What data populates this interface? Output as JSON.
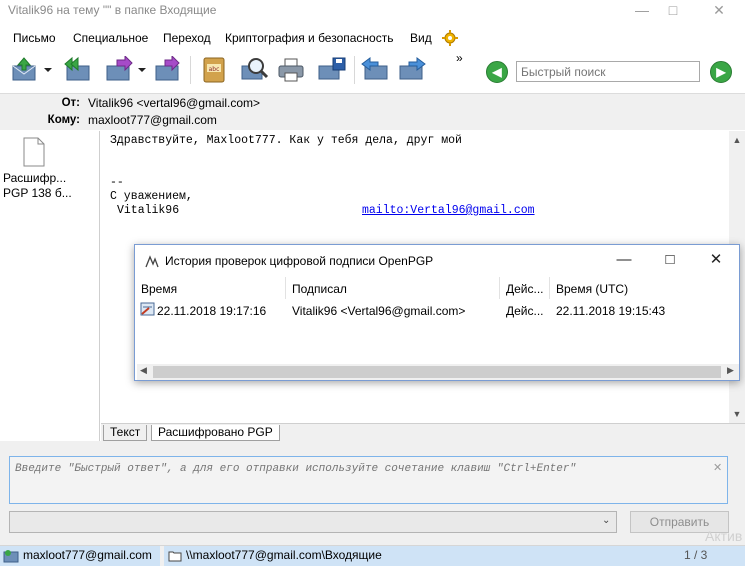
{
  "window": {
    "title": "Vitalik96 на тему \"\" в папке Входящие"
  },
  "menu": [
    "Письмо",
    "Специальное",
    "Переход",
    "Криптография и безопасность",
    "Вид"
  ],
  "toolbar": {
    "more_label": "»",
    "search_placeholder": "Быстрый поиск"
  },
  "header": {
    "from_label": "От:",
    "from_value": "Vitalik96 <vertal96@gmail.com>",
    "to_label": "Кому:",
    "to_value": "maxloot777@gmail.com"
  },
  "attachment": {
    "name": "Расшифр...",
    "details": "PGP 138 б..."
  },
  "message": {
    "line1": "Здравствуйте, Maxloot777. Как у тебя дела, друг мой",
    "sig_dash": "--",
    "sig_regards": "С уважением,",
    "sig_name": "Vitalik96",
    "sig_link": "mailto:Vertal96@gmail.com"
  },
  "body_tabs": [
    "Текст",
    "Расшифровано PGP"
  ],
  "dialog": {
    "title": "История проверок цифровой подписи OpenPGP",
    "columns": [
      "Время",
      "Подписал",
      "Дейс...",
      "Время (UTC)"
    ],
    "rows": [
      {
        "time": "22.11.2018 19:17:16",
        "signer": "Vitalik96 <Vertal96@gmail.com>",
        "action": "Дейс...",
        "utc": "22.11.2018 19:15:43"
      }
    ]
  },
  "reply": {
    "placeholder": "Введите \"Быстрый ответ\", а для его отправки используйте сочетание клавиш \"Ctrl+Enter\"",
    "send_label": "Отправить"
  },
  "statusbar": {
    "account": "maxloot777@gmail.com",
    "folder": "\\\\maxloot777@gmail.com\\Входящие",
    "counter": "1 / 3"
  },
  "watermark": "Актив",
  "colors": {
    "accent_green": "#3aa645",
    "link_blue": "#0000ee",
    "status_highlight": "#cfe3f6"
  }
}
